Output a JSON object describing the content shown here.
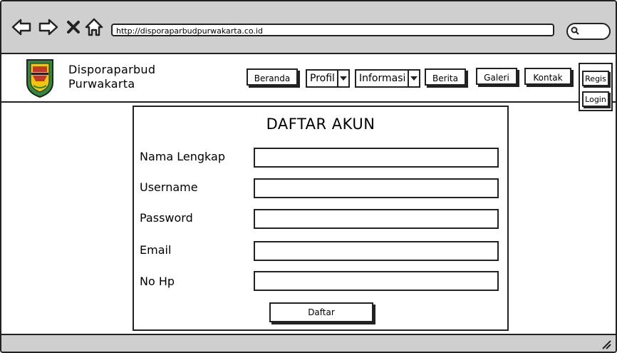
{
  "browser": {
    "url": "http://disporaparbudpurwakarta.co.id"
  },
  "site": {
    "name_line1": "Disporaparbud",
    "name_line2": "Purwakarta"
  },
  "nav": {
    "beranda": "Beranda",
    "profil": "Profil",
    "informasi": "Informasi",
    "berita": "Berita",
    "galeri": "Galeri",
    "kontak": "Kontak",
    "regis": "Regis",
    "login": "Login"
  },
  "form": {
    "title": "DAFTAR AKUN",
    "fields": [
      {
        "label": "Nama Lengkap",
        "value": ""
      },
      {
        "label": "Username",
        "value": ""
      },
      {
        "label": "Password",
        "value": ""
      },
      {
        "label": "Email",
        "value": ""
      },
      {
        "label": "No Hp",
        "value": ""
      }
    ],
    "submit_label": "Daftar"
  },
  "colors": {
    "chrome_gray": "#cfcfcf",
    "stroke": "#222222",
    "logo_green": "#2e8b3d",
    "logo_red": "#c0392b",
    "logo_yellow": "#f1c40f"
  }
}
